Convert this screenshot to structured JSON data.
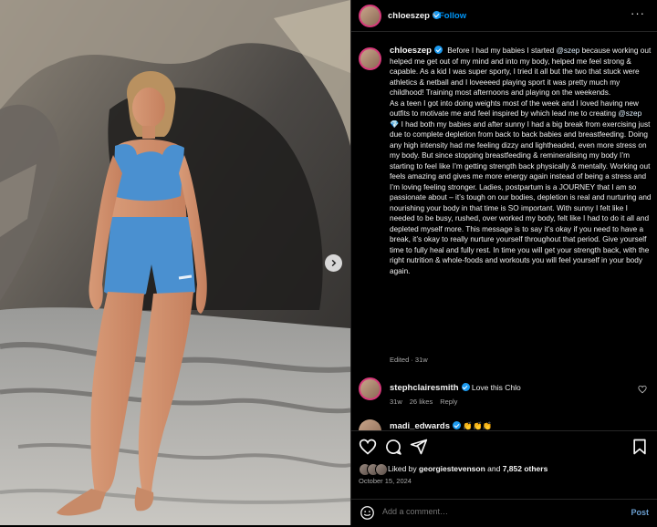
{
  "post": {
    "username": "chloeszep",
    "follow_label": "Follow",
    "separator": "•",
    "more_icon": "more-horizontal-icon",
    "caption": {
      "seg1": "Before I had my babies I started ",
      "mention1": "@szep",
      "seg2": " because working out helped me get out of my mind and into my body, helped me feel strong & capable. As a kid I was super sporty, I tried it all but the two that stuck were athletics & netball and I loveeeed playing sport it was pretty much my childhood! Training most afternoons and playing on the weekends.",
      "seg3": "As a teen I got into doing weights most of the week and I loved having new outfits to motivate me and feel inspired by which lead me to creating ",
      "mention2": "@szep",
      "emoji": "💎",
      "seg4": " I had both my babies and after sunny I had a big break from exercising just due to complete depletion from back to back babies and breastfeeding. Doing any high intensity had me feeling dizzy and lightheaded, even more stress on my body. But since stopping breastfeeding & remineralising my body I’m starting to feel like I’m getting strength back physically & mentally. Working out feels amazing and gives me more energy again instead of being a stress and I’m loving feeling stronger. Ladies, postpartum is a JOURNEY that I am so passionate about – it’s tough on our bodies, depletion is real and nurturing and nourishing your body in that time is SO important. With sunny I felt like I needed to be busy, rushed, over worked my body, felt like I had to do it all and depleted myself more. This message is to say it’s okay if you need to have a break, it’s okay to really nurture yourself throughout that period. Give yourself time to fully heal and fully rest. In time you will get your strength back, with the right nutrition & whole-foods and workouts you will feel yourself in your body again."
    },
    "edited_label": "Edited · 31w",
    "likes": {
      "prefix": "Liked by ",
      "user": "georgiestevenson",
      "middle": " and ",
      "count": "7,852 others"
    },
    "date": "October 15, 2024"
  },
  "comments": [
    {
      "username": "stephclairesmith",
      "text": "Love this Chlo",
      "age": "31w",
      "likes": "26 likes",
      "reply": "Reply"
    },
    {
      "username": "madi_edwards",
      "text": "👏👏👏"
    }
  ],
  "composer": {
    "placeholder": "Add a comment…",
    "post_label": "Post"
  },
  "icons": {
    "like": "heart-icon",
    "comment": "comment-icon",
    "share": "send-icon",
    "save": "bookmark-icon",
    "emoji": "smile-icon",
    "next": "chevron-right-icon"
  },
  "colors": {
    "link": "#0095f6",
    "verified": "#1d9bf0",
    "background": "#000000",
    "post_button": "#6a9ed0"
  }
}
